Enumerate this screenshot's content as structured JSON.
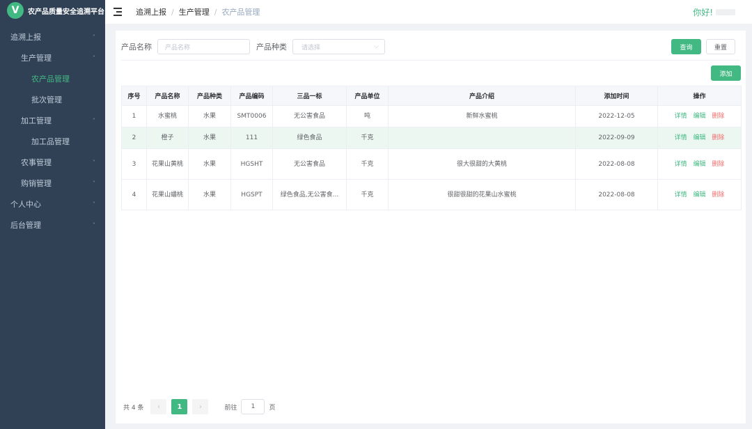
{
  "app": {
    "logo_letter": "V",
    "title": "农产品质量安全追溯平台"
  },
  "sidebar": {
    "items": [
      {
        "label": "追溯上报",
        "chevron": "˄"
      },
      {
        "label": "生产管理",
        "chevron": "˄"
      },
      {
        "label": "农产品管理"
      },
      {
        "label": "批次管理"
      },
      {
        "label": "加工管理",
        "chevron": "˄"
      },
      {
        "label": "加工品管理"
      },
      {
        "label": "农事管理",
        "chevron": "˅"
      },
      {
        "label": "购销管理",
        "chevron": "˅"
      },
      {
        "label": "个人中心",
        "chevron": "˅"
      },
      {
        "label": "后台管理",
        "chevron": "˅"
      }
    ]
  },
  "header": {
    "breadcrumb": [
      "追溯上报",
      "生产管理",
      "农产品管理"
    ],
    "separator": "/",
    "greeting": "你好!"
  },
  "search": {
    "name_label": "产品名称",
    "name_placeholder": "产品名称",
    "type_label": "产品种类",
    "type_placeholder": "请选择",
    "query_label": "查询",
    "reset_label": "重置"
  },
  "toolbar": {
    "add_label": "添加"
  },
  "table": {
    "columns": [
      "序号",
      "产品名称",
      "产品种类",
      "产品编码",
      "三品一标",
      "产品单位",
      "产品介绍",
      "添加时间",
      "操作"
    ],
    "rows": [
      {
        "index": "1",
        "name": "水蜜桃",
        "type": "水果",
        "code": "SMT0006",
        "cert": "无公害食品",
        "unit": "吨",
        "intro": "新鲜水蜜桃",
        "time": "2022-12-05"
      },
      {
        "index": "2",
        "name": "橙子",
        "type": "水果",
        "code": "111",
        "cert": "绿色食品",
        "unit": "千克",
        "intro": "",
        "time": "2022-09-09"
      },
      {
        "index": "3",
        "name": "花果山黄桃",
        "type": "水果",
        "code": "HGSHT",
        "cert": "无公害食品",
        "unit": "千克",
        "intro": "很大很甜的大黄桃",
        "time": "2022-08-08"
      },
      {
        "index": "4",
        "name": "花果山蟠桃",
        "type": "水果",
        "code": "HGSPT",
        "cert": "绿色食品,无公害食...",
        "unit": "千克",
        "intro": "很甜很甜的花果山水蜜桃",
        "time": "2022-08-08"
      }
    ],
    "actions": {
      "detail": "详情",
      "edit": "编辑",
      "delete": "删除"
    }
  },
  "pagination": {
    "total": "共 4 条",
    "prev": "‹",
    "current": "1",
    "next": "›",
    "goto_label": "前往",
    "goto_value": "1",
    "page_suffix": "页"
  },
  "colors": {
    "sidebar_bg": "#304156",
    "accent": "#42b983",
    "danger": "#f56c6c"
  }
}
